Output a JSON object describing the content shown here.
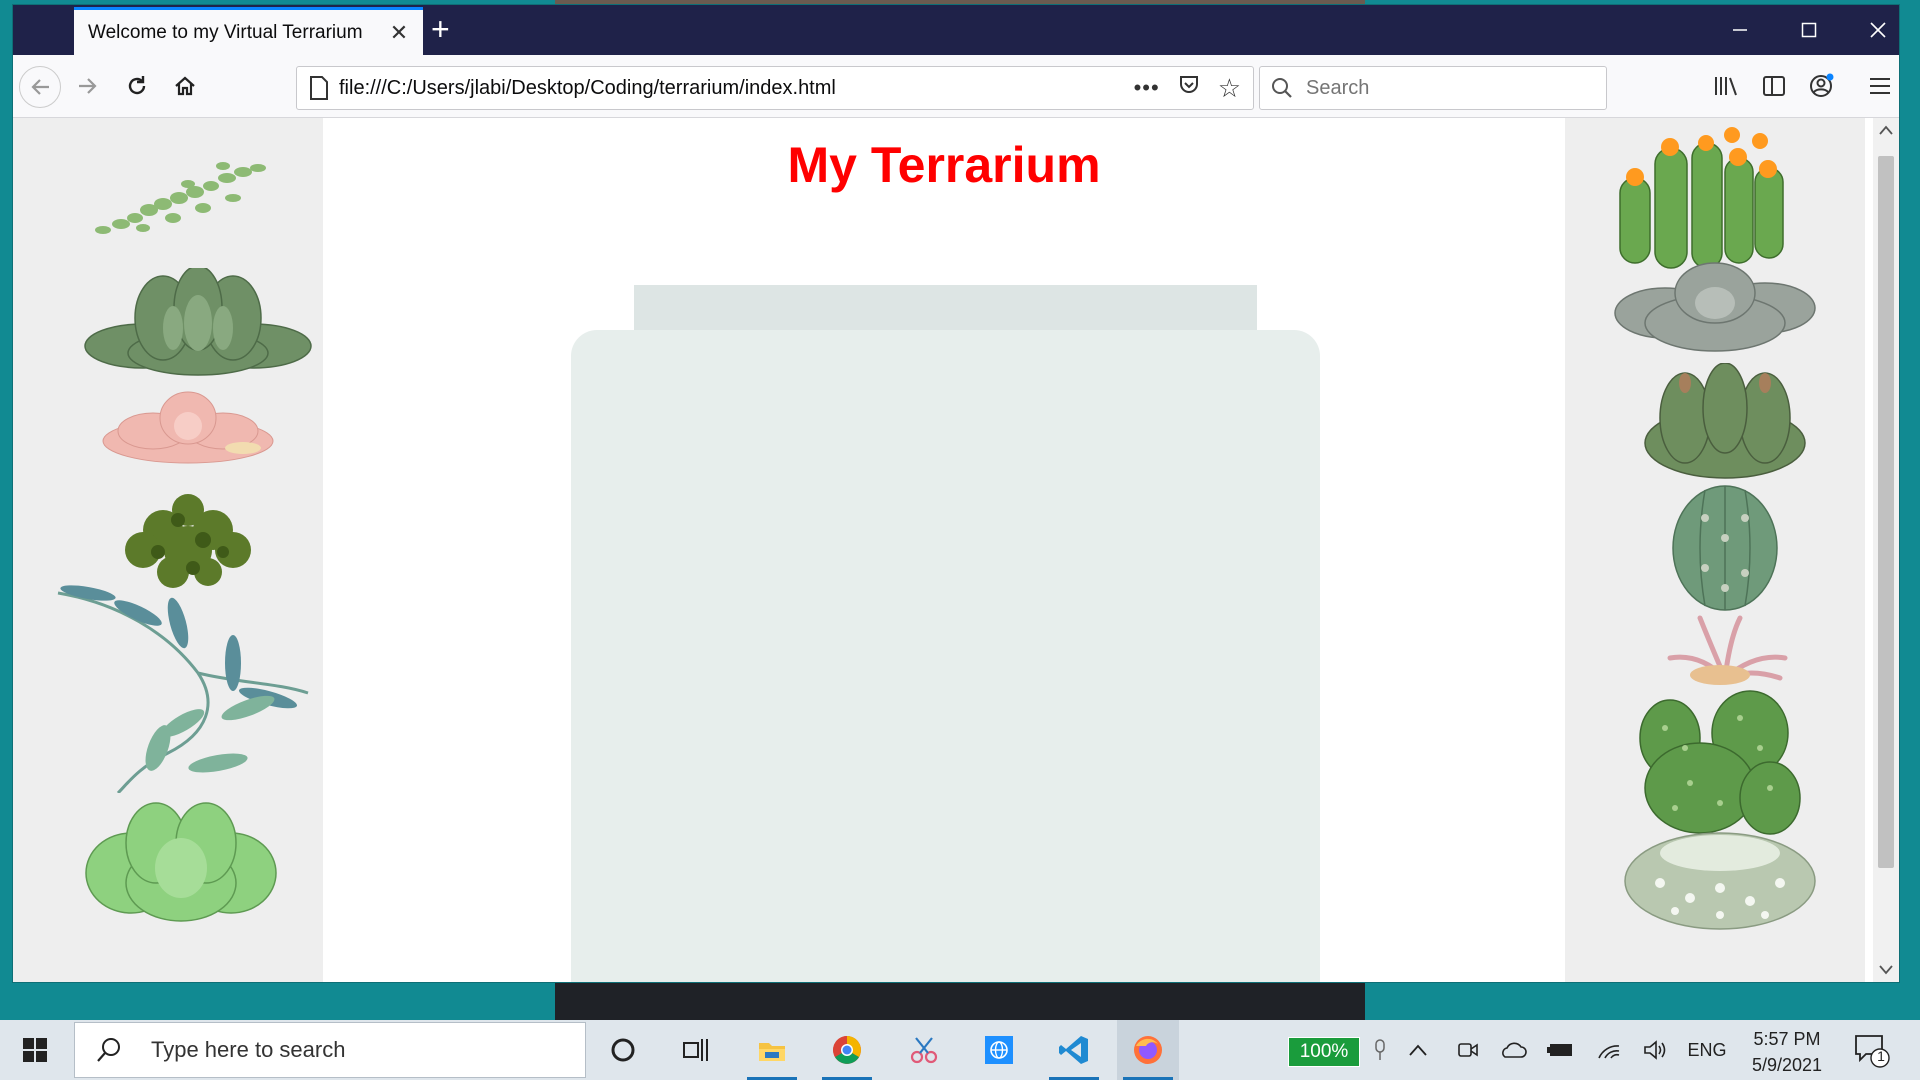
{
  "browser": {
    "tab_title": "Welcome to my Virtual Terrarium",
    "url": "file:///C:/Users/jlabi/Desktop/Coding/terrarium/index.html",
    "search_placeholder": "Search"
  },
  "page": {
    "title": "My Terrarium",
    "title_color": "#ff0000",
    "jar_color": "#e7eeec",
    "container_color": "#eeeeee"
  },
  "plants": {
    "left": [
      "plant-1",
      "plant-2",
      "plant-3",
      "plant-4",
      "plant-5",
      "plant-6",
      "plant-7"
    ],
    "right": [
      "plant-8",
      "plant-9",
      "plant-10",
      "plant-11",
      "plant-12",
      "plant-13",
      "plant-14"
    ]
  },
  "taskbar": {
    "search_placeholder": "Type here to search",
    "battery": "100%",
    "language": "ENG",
    "time": "5:57 PM",
    "date": "5/9/2021",
    "notification_count": "1",
    "apps": [
      "cortana-icon",
      "task-view-icon",
      "file-explorer-icon",
      "chrome-icon",
      "snip-sketch-icon",
      "browser-app-icon",
      "vscode-icon",
      "firefox-icon"
    ]
  }
}
